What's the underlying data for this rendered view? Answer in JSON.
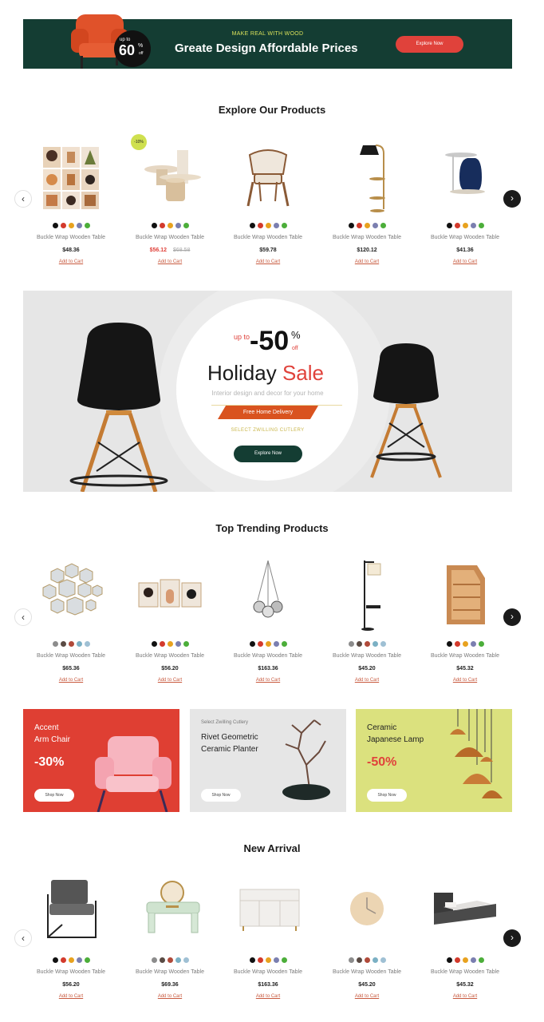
{
  "top_banner": {
    "kicker": "MAKE REAL WITH WOOD",
    "title": "Greate Design Affordable Prices",
    "button": "Explore Now",
    "badge": {
      "upto": "up to",
      "value": "60",
      "percent": "%",
      "off": "off"
    }
  },
  "explore": {
    "title": "Explore Our Products",
    "prev": "‹",
    "next": "›",
    "products": [
      {
        "name": "Buckle Wrap Wooden Table",
        "price": "$48.36",
        "cart": "Add to Cart"
      },
      {
        "name": "Buckle Wrap Wooden Table",
        "price": "$56.12",
        "old_price": "$68.58",
        "badge": "-10%",
        "cart": "Add to Cart"
      },
      {
        "name": "Buckle Wrap Wooden Table",
        "price": "$59.78",
        "cart": "Add to Cart"
      },
      {
        "name": "Buckle Wrap Wooden Table",
        "price": "$120.12",
        "cart": "Add to Cart"
      },
      {
        "name": "Buckle Wrap Wooden Table",
        "price": "$41.36",
        "cart": "Add to Cart"
      }
    ]
  },
  "holiday": {
    "upto": "up to",
    "value": "-50",
    "percent": "%",
    "off": "off",
    "title_a": "Holiday",
    "title_b": "Sale",
    "subtitle": "Interior design and decor for your home",
    "ribbon": "Free Home Delivery",
    "select": "SELECT ZWILLING CUTLERY",
    "button": "Explore Now"
  },
  "trending": {
    "title": "Top Trending Products",
    "prev": "‹",
    "next": "›",
    "products": [
      {
        "name": "Buckle Wrap Wooden Table",
        "price": "$65.36",
        "cart": "Add to Cart"
      },
      {
        "name": "Buckle Wrap Wooden Table",
        "price": "$56.20",
        "cart": "Add to Cart"
      },
      {
        "name": "Buckle Wrap Wooden Table",
        "price": "$163.36",
        "cart": "Add to Cart"
      },
      {
        "name": "Buckle Wrap Wooden Table",
        "price": "$45.20",
        "cart": "Add to Cart"
      },
      {
        "name": "Buckle Wrap Wooden Table",
        "price": "$45.32",
        "cart": "Add to Cart"
      }
    ]
  },
  "promos": [
    {
      "title_1": "Accent",
      "title_2": "Arm Chair",
      "discount": "-30%",
      "button": "Shop Now"
    },
    {
      "kicker": "Select Zwilling Cutlery",
      "title_1": "Rivet Geometric",
      "title_2": "Ceramic Planter",
      "button": "Shop Now"
    },
    {
      "title_1": "Ceramic",
      "title_2": "Japanese Lamp",
      "discount": "-50%",
      "button": "Shop Now"
    }
  ],
  "new_arrival": {
    "title": "New Arrival",
    "prev": "‹",
    "next": "›",
    "products": [
      {
        "name": "Buckle Wrap Wooden Table",
        "price": "$56.20",
        "cart": "Add to Cart"
      },
      {
        "name": "Buckle Wrap Wooden Table",
        "price": "$69.36",
        "cart": "Add to Cart"
      },
      {
        "name": "Buckle Wrap Wooden Table",
        "price": "$163.36",
        "cart": "Add to Cart"
      },
      {
        "name": "Buckle Wrap Wooden Table",
        "price": "$45.20",
        "cart": "Add to Cart"
      },
      {
        "name": "Buckle Wrap Wooden Table",
        "price": "$45.32",
        "cart": "Add to Cart"
      }
    ]
  },
  "colors": {
    "dark_green": "#143d33",
    "accent_red": "#e0423b",
    "promo_red": "#df3f33",
    "promo_gray": "#e6e6e6",
    "promo_yellow": "#dbe17e",
    "swatches_a": [
      "#111111",
      "#d33a2c",
      "#e8a21f",
      "#7b7fb0",
      "#4cae3a"
    ],
    "swatches_b": [
      "#8c8c8c",
      "#5a4b44",
      "#b04a3a",
      "#7bb0c4",
      "#9fc0d4"
    ]
  }
}
